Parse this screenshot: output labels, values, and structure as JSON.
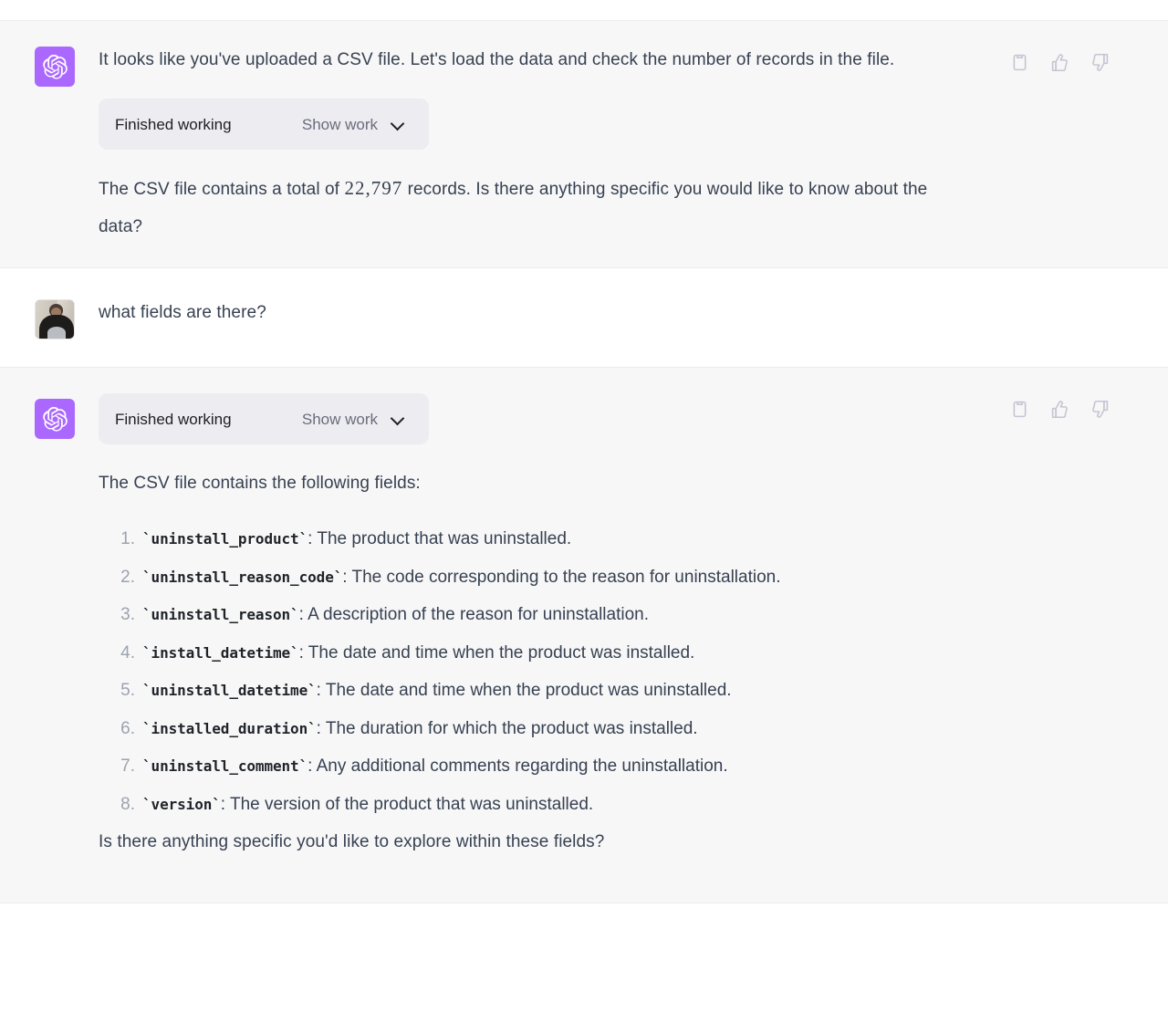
{
  "conversation": {
    "messages": [
      {
        "role": "assistant",
        "avatar_icon": "openai-logo-icon",
        "paragraph_1": "It looks like you've uploaded a CSV file. Let's load the data and check the number of records in the file.",
        "tool": {
          "status_label": "Finished working",
          "action_label": "Show work",
          "chevron_icon": "chevron-down-icon"
        },
        "paragraph_2_before": "The CSV file contains a total of ",
        "paragraph_2_number": "22,797",
        "paragraph_2_after": " records. Is there anything specific you would like to know about the data?",
        "actions": {
          "copy_label": "copy-icon",
          "thumbs_up_label": "thumbs-up-icon",
          "thumbs_down_label": "thumbs-down-icon"
        }
      },
      {
        "role": "user",
        "avatar_icon": "user-photo-avatar",
        "text": "what fields are there?"
      },
      {
        "role": "assistant",
        "avatar_icon": "openai-logo-icon",
        "tool": {
          "status_label": "Finished working",
          "action_label": "Show work",
          "chevron_icon": "chevron-down-icon"
        },
        "intro": "The CSV file contains the following fields:",
        "fields": [
          {
            "name": "`uninstall_product`",
            "desc": ": The product that was uninstalled."
          },
          {
            "name": "`uninstall_reason_code`",
            "desc": ": The code corresponding to the reason for uninstallation."
          },
          {
            "name": "`uninstall_reason`",
            "desc": ": A description of the reason for uninstallation."
          },
          {
            "name": "`install_datetime`",
            "desc": ": The date and time when the product was installed."
          },
          {
            "name": "`uninstall_datetime`",
            "desc": ": The date and time when the product was uninstalled."
          },
          {
            "name": "`installed_duration`",
            "desc": ": The duration for which the product was installed."
          },
          {
            "name": "`uninstall_comment`",
            "desc": ": Any additional comments regarding the uninstallation."
          },
          {
            "name": "`version`",
            "desc": ": The version of the product that was uninstalled."
          }
        ],
        "closing": "Is there anything specific you'd like to explore within these fields?",
        "actions": {
          "copy_label": "copy-icon",
          "thumbs_up_label": "thumbs-up-icon",
          "thumbs_down_label": "thumbs-down-icon"
        }
      }
    ]
  },
  "colors": {
    "assistant_background": "#f7f7f8",
    "user_background": "#ffffff",
    "avatar_accent": "#ab68ff",
    "tool_block_background": "#ececf1",
    "text": "#374151",
    "muted_text": "#9ca3af",
    "icon": "#c5c5d2"
  }
}
